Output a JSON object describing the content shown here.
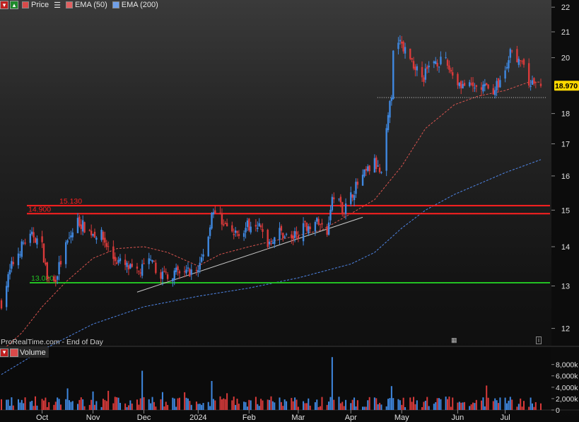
{
  "legend": {
    "items": [
      {
        "label": "Price",
        "color": "#d94a4a"
      },
      {
        "label": "EMA (50)",
        "color": "#e06060"
      },
      {
        "label": "EMA (200)",
        "color": "#6f9fe8"
      }
    ],
    "menu_icon": "list-icon"
  },
  "watermark": "ProRealTime.com - End of Day",
  "volume_label": "Volume",
  "price_badge": "18.970",
  "colors": {
    "up": "#3f88e0",
    "down": "#d93a3a",
    "ema50": "#d9544f",
    "ema200": "#4f86e8",
    "resistance": "#ff2020",
    "support": "#22c022",
    "trend": "#c8c8c8",
    "badge_bg": "#ffd800"
  },
  "chart_data": [
    {
      "type": "candlestick",
      "title": "",
      "yscale": "log",
      "ylim": [
        11.6,
        22.3
      ],
      "y_ticks": [
        12,
        13,
        14,
        15,
        16,
        17,
        18,
        20,
        21,
        22
      ],
      "x_tick_labels": [
        "Oct",
        "Nov",
        "Dec",
        "2024",
        "Feb",
        "Mar",
        "Apr",
        "May",
        "Jun",
        "Jul"
      ],
      "x_tick_dates": [
        "2023-10-02",
        "2023-11-01",
        "2023-12-01",
        "2024-01-02",
        "2024-02-01",
        "2024-03-01",
        "2024-04-01",
        "2024-05-01",
        "2024-06-03",
        "2024-07-01"
      ],
      "date_range": [
        "2023-09-08",
        "2024-07-22"
      ],
      "close_path": [
        [
          "2023-09-08",
          12.6
        ],
        [
          "2023-09-14",
          13.5
        ],
        [
          "2023-09-21",
          14.1
        ],
        [
          "2023-09-27",
          14.3
        ],
        [
          "2023-10-02",
          14.0
        ],
        [
          "2023-10-05",
          13.2
        ],
        [
          "2023-10-09",
          13.1
        ],
        [
          "2023-10-16",
          14.0
        ],
        [
          "2023-10-23",
          14.7
        ],
        [
          "2023-10-30",
          14.4
        ],
        [
          "2023-11-06",
          14.3
        ],
        [
          "2023-11-13",
          13.7
        ],
        [
          "2023-11-20",
          13.5
        ],
        [
          "2023-11-27",
          13.3
        ],
        [
          "2023-12-04",
          13.6
        ],
        [
          "2023-12-11",
          13.3
        ],
        [
          "2023-12-18",
          13.3
        ],
        [
          "2024-01-02",
          13.4
        ],
        [
          "2024-01-08",
          14.3
        ],
        [
          "2024-01-10",
          15.0
        ],
        [
          "2024-01-15",
          14.8
        ],
        [
          "2024-01-22",
          14.3
        ],
        [
          "2024-01-29",
          14.5
        ],
        [
          "2024-02-05",
          14.7
        ],
        [
          "2024-02-12",
          14.1
        ],
        [
          "2024-02-19",
          14.4
        ],
        [
          "2024-02-26",
          14.2
        ],
        [
          "2024-03-04",
          14.5
        ],
        [
          "2024-03-11",
          14.7
        ],
        [
          "2024-03-18",
          14.4
        ],
        [
          "2024-03-21",
          15.5
        ],
        [
          "2024-03-28",
          15.0
        ],
        [
          "2024-04-03",
          15.6
        ],
        [
          "2024-04-10",
          16.1
        ],
        [
          "2024-04-15",
          16.4
        ],
        [
          "2024-04-19",
          16.0
        ],
        [
          "2024-04-25",
          18.7
        ],
        [
          "2024-04-26",
          20.2
        ],
        [
          "2024-04-30",
          20.6
        ],
        [
          "2024-05-06",
          20.0
        ],
        [
          "2024-05-13",
          19.2
        ],
        [
          "2024-05-20",
          19.9
        ],
        [
          "2024-05-27",
          19.8
        ],
        [
          "2024-06-03",
          19.1
        ],
        [
          "2024-06-10",
          18.9
        ],
        [
          "2024-06-17",
          18.9
        ],
        [
          "2024-06-24",
          18.8
        ],
        [
          "2024-07-01",
          19.4
        ],
        [
          "2024-07-05",
          20.4
        ],
        [
          "2024-07-10",
          19.8
        ],
        [
          "2024-07-15",
          19.1
        ],
        [
          "2024-07-22",
          18.97
        ]
      ],
      "ema50": [
        [
          "2023-09-08",
          11.5
        ],
        [
          "2023-09-20",
          11.9
        ],
        [
          "2023-10-02",
          12.5
        ],
        [
          "2023-10-16",
          13.1
        ],
        [
          "2023-11-01",
          13.7
        ],
        [
          "2023-11-15",
          13.95
        ],
        [
          "2023-12-01",
          14.0
        ],
        [
          "2023-12-15",
          13.85
        ],
        [
          "2024-01-02",
          13.5
        ],
        [
          "2024-01-15",
          13.8
        ],
        [
          "2024-02-01",
          14.0
        ],
        [
          "2024-02-15",
          14.15
        ],
        [
          "2024-03-01",
          14.3
        ],
        [
          "2024-03-15",
          14.45
        ],
        [
          "2024-04-01",
          14.9
        ],
        [
          "2024-04-15",
          15.3
        ],
        [
          "2024-05-01",
          16.3
        ],
        [
          "2024-05-15",
          17.5
        ],
        [
          "2024-06-01",
          18.3
        ],
        [
          "2024-06-15",
          18.6
        ],
        [
          "2024-07-01",
          18.8
        ],
        [
          "2024-07-15",
          19.1
        ],
        [
          "2024-07-22",
          19.1
        ]
      ],
      "ema200": [
        [
          "2023-09-08",
          11.0
        ],
        [
          "2023-10-01",
          11.5
        ],
        [
          "2023-11-01",
          12.1
        ],
        [
          "2023-12-01",
          12.5
        ],
        [
          "2024-01-02",
          12.75
        ],
        [
          "2024-02-01",
          12.95
        ],
        [
          "2024-03-01",
          13.2
        ],
        [
          "2024-04-01",
          13.55
        ],
        [
          "2024-04-15",
          13.85
        ],
        [
          "2024-05-01",
          14.5
        ],
        [
          "2024-05-15",
          15.0
        ],
        [
          "2024-06-01",
          15.45
        ],
        [
          "2024-06-15",
          15.75
        ],
        [
          "2024-07-01",
          16.1
        ],
        [
          "2024-07-22",
          16.5
        ]
      ],
      "horizontal_levels": [
        {
          "label": "15.130",
          "value": 15.13
        },
        {
          "label": "14.900",
          "value": 14.9
        },
        {
          "label": "13.080",
          "value": 13.08
        }
      ],
      "trendline": [
        [
          "2023-11-27",
          12.85
        ],
        [
          "2024-04-08",
          14.8
        ]
      ],
      "gap_reference": {
        "value": 18.55,
        "from": "2024-04-25",
        "to": "2024-07-22"
      },
      "last_price": 18.97
    },
    {
      "type": "bar",
      "title": "Volume",
      "ylim": [
        0,
        9200
      ],
      "y_tick_labels": [
        "0",
        "2,000k",
        "4,000k",
        "6,000k",
        "8,000k"
      ],
      "y_tick_values": [
        0,
        2000,
        4000,
        6000,
        8000
      ],
      "units": "thousands",
      "spikes": [
        [
          "2023-11-30",
          6900
        ],
        [
          "2024-01-10",
          5100
        ],
        [
          "2024-03-21",
          9300
        ],
        [
          "2024-04-25",
          4200
        ],
        [
          "2024-06-20",
          4300
        ]
      ],
      "typical_range": [
        500,
        2400
      ]
    }
  ]
}
